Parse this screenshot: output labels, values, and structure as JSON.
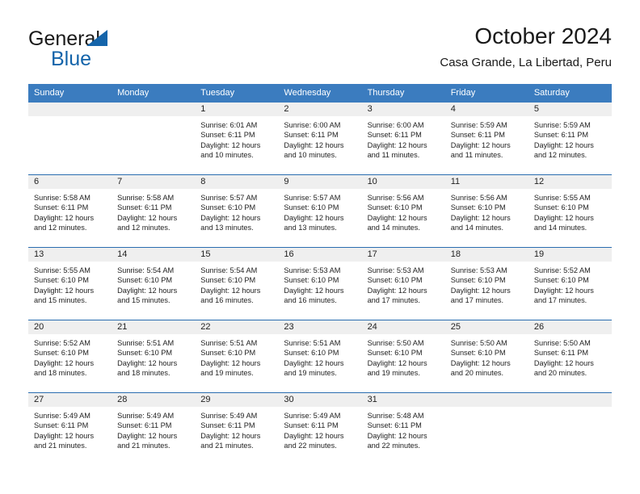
{
  "brand": {
    "word1": "General",
    "word2": "Blue",
    "accent_color": "#1464aa",
    "triangle_icon": "triangle-icon"
  },
  "header": {
    "title": "October 2024",
    "subtitle": "Casa Grande, La Libertad, Peru"
  },
  "calendar": {
    "header_bg": "#3b7cbf",
    "daynum_band_bg": "#efefef",
    "row_border_color": "#2a6db0",
    "weekdays": [
      "Sunday",
      "Monday",
      "Tuesday",
      "Wednesday",
      "Thursday",
      "Friday",
      "Saturday"
    ],
    "weeks": [
      [
        {
          "day": "",
          "lines": []
        },
        {
          "day": "",
          "lines": []
        },
        {
          "day": "1",
          "lines": [
            "Sunrise: 6:01 AM",
            "Sunset: 6:11 PM",
            "Daylight: 12 hours",
            "and 10 minutes."
          ]
        },
        {
          "day": "2",
          "lines": [
            "Sunrise: 6:00 AM",
            "Sunset: 6:11 PM",
            "Daylight: 12 hours",
            "and 10 minutes."
          ]
        },
        {
          "day": "3",
          "lines": [
            "Sunrise: 6:00 AM",
            "Sunset: 6:11 PM",
            "Daylight: 12 hours",
            "and 11 minutes."
          ]
        },
        {
          "day": "4",
          "lines": [
            "Sunrise: 5:59 AM",
            "Sunset: 6:11 PM",
            "Daylight: 12 hours",
            "and 11 minutes."
          ]
        },
        {
          "day": "5",
          "lines": [
            "Sunrise: 5:59 AM",
            "Sunset: 6:11 PM",
            "Daylight: 12 hours",
            "and 12 minutes."
          ]
        }
      ],
      [
        {
          "day": "6",
          "lines": [
            "Sunrise: 5:58 AM",
            "Sunset: 6:11 PM",
            "Daylight: 12 hours",
            "and 12 minutes."
          ]
        },
        {
          "day": "7",
          "lines": [
            "Sunrise: 5:58 AM",
            "Sunset: 6:11 PM",
            "Daylight: 12 hours",
            "and 12 minutes."
          ]
        },
        {
          "day": "8",
          "lines": [
            "Sunrise: 5:57 AM",
            "Sunset: 6:10 PM",
            "Daylight: 12 hours",
            "and 13 minutes."
          ]
        },
        {
          "day": "9",
          "lines": [
            "Sunrise: 5:57 AM",
            "Sunset: 6:10 PM",
            "Daylight: 12 hours",
            "and 13 minutes."
          ]
        },
        {
          "day": "10",
          "lines": [
            "Sunrise: 5:56 AM",
            "Sunset: 6:10 PM",
            "Daylight: 12 hours",
            "and 14 minutes."
          ]
        },
        {
          "day": "11",
          "lines": [
            "Sunrise: 5:56 AM",
            "Sunset: 6:10 PM",
            "Daylight: 12 hours",
            "and 14 minutes."
          ]
        },
        {
          "day": "12",
          "lines": [
            "Sunrise: 5:55 AM",
            "Sunset: 6:10 PM",
            "Daylight: 12 hours",
            "and 14 minutes."
          ]
        }
      ],
      [
        {
          "day": "13",
          "lines": [
            "Sunrise: 5:55 AM",
            "Sunset: 6:10 PM",
            "Daylight: 12 hours",
            "and 15 minutes."
          ]
        },
        {
          "day": "14",
          "lines": [
            "Sunrise: 5:54 AM",
            "Sunset: 6:10 PM",
            "Daylight: 12 hours",
            "and 15 minutes."
          ]
        },
        {
          "day": "15",
          "lines": [
            "Sunrise: 5:54 AM",
            "Sunset: 6:10 PM",
            "Daylight: 12 hours",
            "and 16 minutes."
          ]
        },
        {
          "day": "16",
          "lines": [
            "Sunrise: 5:53 AM",
            "Sunset: 6:10 PM",
            "Daylight: 12 hours",
            "and 16 minutes."
          ]
        },
        {
          "day": "17",
          "lines": [
            "Sunrise: 5:53 AM",
            "Sunset: 6:10 PM",
            "Daylight: 12 hours",
            "and 17 minutes."
          ]
        },
        {
          "day": "18",
          "lines": [
            "Sunrise: 5:53 AM",
            "Sunset: 6:10 PM",
            "Daylight: 12 hours",
            "and 17 minutes."
          ]
        },
        {
          "day": "19",
          "lines": [
            "Sunrise: 5:52 AM",
            "Sunset: 6:10 PM",
            "Daylight: 12 hours",
            "and 17 minutes."
          ]
        }
      ],
      [
        {
          "day": "20",
          "lines": [
            "Sunrise: 5:52 AM",
            "Sunset: 6:10 PM",
            "Daylight: 12 hours",
            "and 18 minutes."
          ]
        },
        {
          "day": "21",
          "lines": [
            "Sunrise: 5:51 AM",
            "Sunset: 6:10 PM",
            "Daylight: 12 hours",
            "and 18 minutes."
          ]
        },
        {
          "day": "22",
          "lines": [
            "Sunrise: 5:51 AM",
            "Sunset: 6:10 PM",
            "Daylight: 12 hours",
            "and 19 minutes."
          ]
        },
        {
          "day": "23",
          "lines": [
            "Sunrise: 5:51 AM",
            "Sunset: 6:10 PM",
            "Daylight: 12 hours",
            "and 19 minutes."
          ]
        },
        {
          "day": "24",
          "lines": [
            "Sunrise: 5:50 AM",
            "Sunset: 6:10 PM",
            "Daylight: 12 hours",
            "and 19 minutes."
          ]
        },
        {
          "day": "25",
          "lines": [
            "Sunrise: 5:50 AM",
            "Sunset: 6:10 PM",
            "Daylight: 12 hours",
            "and 20 minutes."
          ]
        },
        {
          "day": "26",
          "lines": [
            "Sunrise: 5:50 AM",
            "Sunset: 6:11 PM",
            "Daylight: 12 hours",
            "and 20 minutes."
          ]
        }
      ],
      [
        {
          "day": "27",
          "lines": [
            "Sunrise: 5:49 AM",
            "Sunset: 6:11 PM",
            "Daylight: 12 hours",
            "and 21 minutes."
          ]
        },
        {
          "day": "28",
          "lines": [
            "Sunrise: 5:49 AM",
            "Sunset: 6:11 PM",
            "Daylight: 12 hours",
            "and 21 minutes."
          ]
        },
        {
          "day": "29",
          "lines": [
            "Sunrise: 5:49 AM",
            "Sunset: 6:11 PM",
            "Daylight: 12 hours",
            "and 21 minutes."
          ]
        },
        {
          "day": "30",
          "lines": [
            "Sunrise: 5:49 AM",
            "Sunset: 6:11 PM",
            "Daylight: 12 hours",
            "and 22 minutes."
          ]
        },
        {
          "day": "31",
          "lines": [
            "Sunrise: 5:48 AM",
            "Sunset: 6:11 PM",
            "Daylight: 12 hours",
            "and 22 minutes."
          ]
        },
        {
          "day": "",
          "lines": []
        },
        {
          "day": "",
          "lines": []
        }
      ]
    ]
  }
}
